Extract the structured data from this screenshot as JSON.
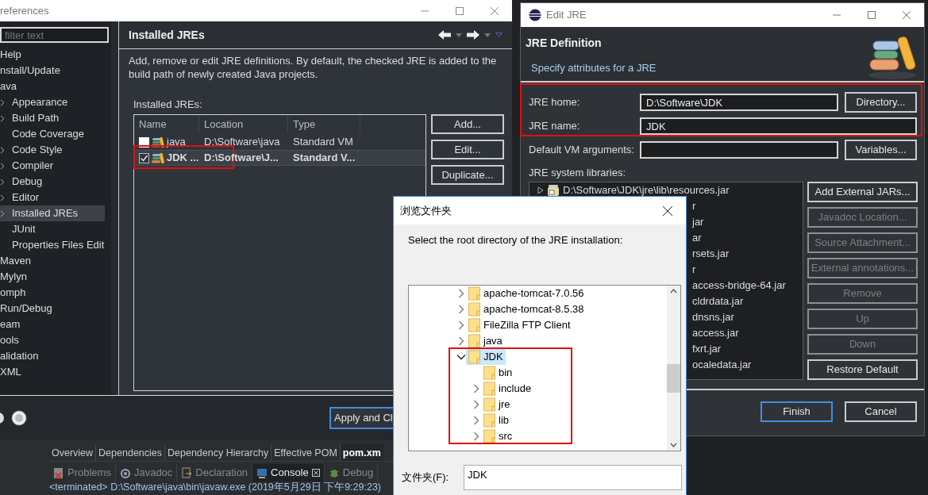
{
  "preferences": {
    "title": "references",
    "filter": {
      "placeholder": "filter text"
    },
    "tree": [
      {
        "label": "Help"
      },
      {
        "label": "nstall/Update"
      },
      {
        "label": "ava",
        "children": [
          {
            "label": "Appearance",
            "expandable": true,
            "selected": false
          },
          {
            "label": "Build Path",
            "expandable": true,
            "selected": false
          },
          {
            "label": "Code Coverage",
            "expandable": false,
            "selected": false
          },
          {
            "label": "Code Style",
            "expandable": true,
            "selected": false
          },
          {
            "label": "Compiler",
            "expandable": true,
            "selected": false
          },
          {
            "label": "Debug",
            "expandable": true,
            "selected": false
          },
          {
            "label": "Editor",
            "expandable": true,
            "selected": false
          },
          {
            "label": "Installed JREs",
            "expandable": true,
            "selected": true
          },
          {
            "label": "JUnit",
            "expandable": false,
            "selected": false
          },
          {
            "label": "Properties Files Edit",
            "expandable": false,
            "selected": false
          }
        ]
      },
      {
        "label": "Maven"
      },
      {
        "label": "Mylyn"
      },
      {
        "label": "omph"
      },
      {
        "label": "Run/Debug"
      },
      {
        "label": "eam"
      },
      {
        "label": "ools"
      },
      {
        "label": "alidation"
      },
      {
        "label": "XML"
      }
    ],
    "page_title": "Installed JREs",
    "description": "Add, remove or edit JRE definitions. By default, the checked JRE is added to the build path of newly created Java projects.",
    "table_label": "Installed JREs:",
    "table": {
      "columns": [
        "Name",
        "Location",
        "Type"
      ],
      "rows": [
        {
          "checked": false,
          "selected": false,
          "name": "java",
          "location": "D:\\Software\\java",
          "type": "Standard VM"
        },
        {
          "checked": true,
          "selected": true,
          "name": "JDK ...",
          "location": "D:\\Software\\J...",
          "type": "Standard V..."
        }
      ]
    },
    "buttons": [
      "Add...",
      "Edit...",
      "Duplicate..."
    ],
    "apply_button": "Apply and Cl"
  },
  "editor_tabs": [
    {
      "label": "Overview",
      "selected": false
    },
    {
      "label": "Dependencies",
      "selected": false
    },
    {
      "label": "Dependency Hierarchy",
      "selected": false
    },
    {
      "label": "Effective POM",
      "selected": false
    },
    {
      "label": "pom.xm",
      "selected": true
    }
  ],
  "view_tabs": [
    {
      "label": "Problems",
      "selected": false,
      "closable": false
    },
    {
      "label": "Javadoc",
      "selected": false,
      "closable": false
    },
    {
      "label": "Declaration",
      "selected": false,
      "closable": false
    },
    {
      "label": "Console",
      "selected": true,
      "closable": true
    },
    {
      "label": "Debug",
      "selected": false,
      "closable": false
    }
  ],
  "console_line": "<terminated> D:\\Software\\java\\bin\\javaw.exe (2019年5月29日 下午9:29:23)",
  "edit_jre": {
    "title": "Edit JRE",
    "heading": "JRE Definition",
    "subheading": "Specify attributes for a JRE",
    "fields": [
      {
        "label": "JRE home:",
        "value": "D:\\Software\\JDK",
        "button": "Directory..."
      },
      {
        "label": "JRE name:",
        "value": "JDK"
      },
      {
        "label": "Default VM arguments:",
        "button": "Variables..."
      }
    ],
    "libraries_label": "JRE system libraries:",
    "libraries": [
      {
        "label": "D:\\Software\\JDK\\jre\\lib\\resources.jar",
        "clipped": false
      },
      {
        "label": "r",
        "clipped": true
      },
      {
        "label": "jar",
        "clipped": true
      },
      {
        "label": "ar",
        "clipped": true
      },
      {
        "label": "rsets.jar",
        "clipped": true
      },
      {
        "label": "r",
        "clipped": true
      },
      {
        "label": "access-bridge-64.jar",
        "clipped": true
      },
      {
        "label": "cldrdata.jar",
        "clipped": true
      },
      {
        "label": "dnsns.jar",
        "clipped": true
      },
      {
        "label": "access.jar",
        "clipped": true
      },
      {
        "label": "fxrt.jar",
        "clipped": true
      },
      {
        "label": "ocaledata.jar",
        "clipped": true
      }
    ],
    "side_buttons": [
      {
        "label": "Add External JARs...",
        "disabled": false
      },
      {
        "label": "Javadoc Location...",
        "disabled": true
      },
      {
        "label": "Source Attachment...",
        "disabled": true
      },
      {
        "label": "External annotations...",
        "disabled": true
      },
      {
        "label": "Remove",
        "disabled": true
      },
      {
        "label": "Up",
        "disabled": true
      },
      {
        "label": "Down",
        "disabled": true
      },
      {
        "label": "Restore Default",
        "disabled": false
      }
    ],
    "finish_button": "Finish",
    "cancel_button": "Cancel"
  },
  "folder_dialog": {
    "title": "浏览文件夹",
    "prompt": "Select the root directory of the JRE installation:",
    "tree": [
      {
        "label": "apache-tomcat-7.0.56",
        "expandable": true,
        "selected": false
      },
      {
        "label": "apache-tomcat-8.5.38",
        "expandable": true,
        "selected": false
      },
      {
        "label": "FileZilla FTP Client",
        "expandable": true,
        "selected": false
      },
      {
        "label": "java",
        "expandable": true,
        "selected": false
      },
      {
        "label": "JDK",
        "expandable": true,
        "selected": true,
        "children": [
          {
            "label": "bin",
            "expandable": false,
            "selected": false
          },
          {
            "label": "include",
            "expandable": true,
            "selected": false
          },
          {
            "label": "jre",
            "expandable": true,
            "selected": false
          },
          {
            "label": "lib",
            "expandable": true,
            "selected": false
          },
          {
            "label": "src",
            "expandable": true,
            "selected": false
          }
        ]
      }
    ],
    "folder_label": "文件夹(F):",
    "folder_value": "JDK"
  }
}
